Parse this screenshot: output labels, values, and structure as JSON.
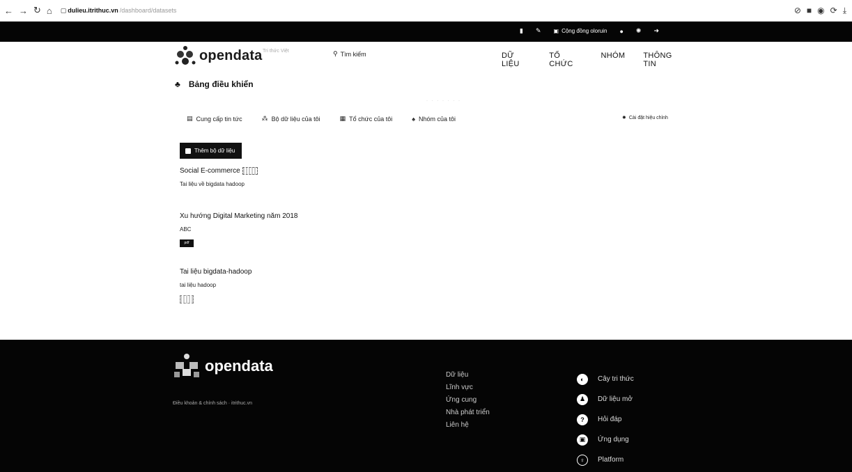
{
  "browser": {
    "url_host": "dulieu.itrithuc.vn",
    "url_path": "/dashboard/datasets"
  },
  "topbar": {
    "community_label": "Cộng đồng oloruin"
  },
  "header": {
    "logo_text": "opendata",
    "tagline": "Tri thức Việt",
    "search_label": "Tìm kiếm",
    "nav": [
      "DỮ LIỆU",
      "TỔ CHỨC",
      "NHÓM",
      "THÔNG TIN"
    ]
  },
  "dashboard": {
    "title": "Bảng điều khiển",
    "tabs": [
      "Cung cấp tin tức",
      "Bộ dữ liệu của tôi",
      "Tổ chức của tôi",
      "Nhóm của tôi"
    ],
    "edit_settings": "Cài đặt hiệu chỉnh",
    "add_button": "Thêm bộ dữ liệu"
  },
  "datasets": [
    {
      "title": "Social E-commerce",
      "desc": "Tai liệu về bigdata hadoop"
    },
    {
      "title": "Xu hướng Digital Marketing năm 2018",
      "desc": "ABC",
      "tag": "pdf"
    },
    {
      "title": "Tai liệu bigdata-hadoop",
      "desc": "tai liệu hadoop"
    }
  ],
  "footer": {
    "logo_text": "opendata",
    "terms": "Điều khoản & chính sách · itrithuc.vn",
    "links": [
      "Dữ liệu",
      "Lĩnh vực",
      "Ứng cung",
      "Nhà phát triển",
      "Liên hệ"
    ],
    "social": [
      "Cây tri thức",
      "Dữ liệu mở",
      "Hỏi đáp",
      "Ứng dụng",
      "Platform"
    ]
  },
  "colors": {
    "bar_black": "#050505",
    "text": "#111111"
  }
}
